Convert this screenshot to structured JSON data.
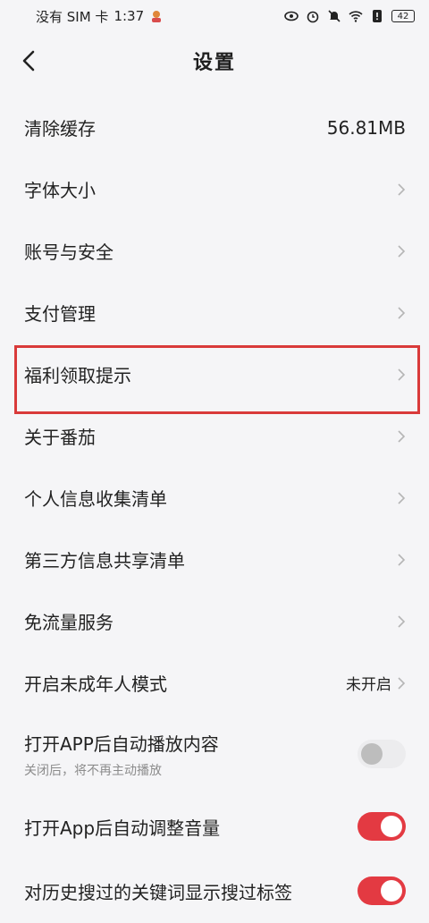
{
  "status_bar": {
    "carrier": "没有 SIM 卡",
    "time": "1:37",
    "battery": "42"
  },
  "header": {
    "title": "设置"
  },
  "settings": {
    "clear_cache": {
      "label": "清除缓存",
      "value": "56.81MB"
    },
    "font_size": {
      "label": "字体大小"
    },
    "account_security": {
      "label": "账号与安全"
    },
    "payment": {
      "label": "支付管理"
    },
    "welfare_tips": {
      "label": "福利领取提示"
    },
    "about": {
      "label": "关于番茄"
    },
    "personal_info_list": {
      "label": "个人信息收集清单"
    },
    "third_party_list": {
      "label": "第三方信息共享清单"
    },
    "free_data": {
      "label": "免流量服务"
    },
    "minor_mode": {
      "label": "开启未成年人模式",
      "value": "未开启"
    },
    "autoplay": {
      "label": "打开APP后自动播放内容",
      "subtitle": "关闭后，将不再主动播放",
      "enabled": false
    },
    "auto_volume": {
      "label": "打开App后自动调整音量",
      "enabled": true
    },
    "search_history_tags": {
      "label": "对历史搜过的关键词显示搜过标签",
      "enabled": true
    }
  },
  "colors": {
    "accent": "#e33a42",
    "highlight_border": "#d93a3a",
    "background": "#f5f5f7"
  }
}
